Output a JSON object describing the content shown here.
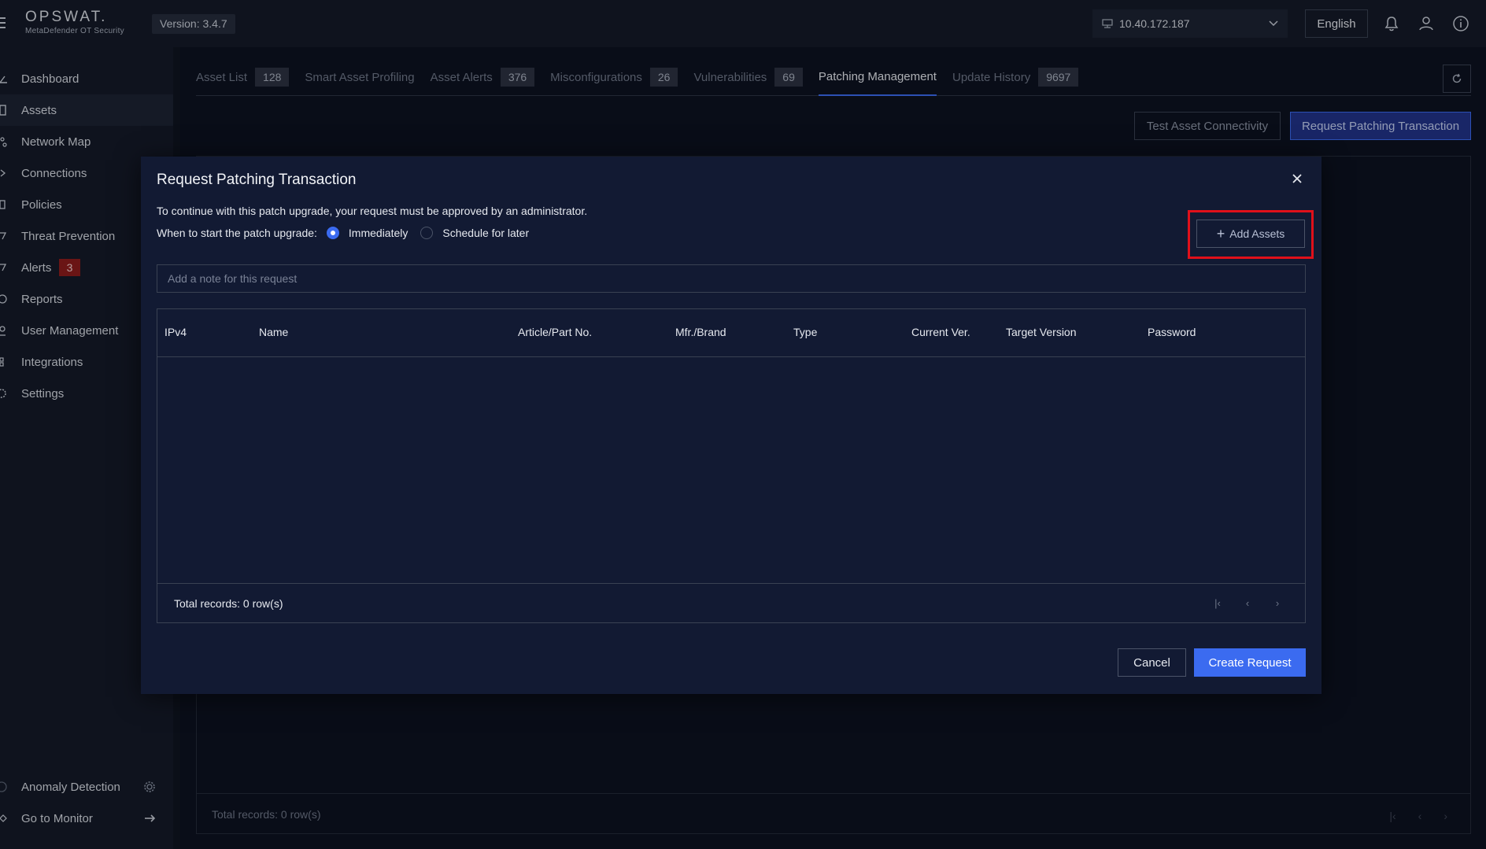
{
  "app": {
    "brand": "OPSWAT.",
    "product": "MetaDefender OT Security",
    "version": "Version: 3.4.7"
  },
  "topbar": {
    "ip": "10.40.172.187",
    "language": "English",
    "icons": [
      "network-icon",
      "chevron-down-icon",
      "bell-icon",
      "user-icon",
      "info-icon"
    ]
  },
  "sidebar": {
    "items": [
      {
        "label": "Dashboard",
        "icon": "dashboard-icon"
      },
      {
        "label": "Assets",
        "icon": "assets-icon",
        "active": true
      },
      {
        "label": "Network Map",
        "icon": "network-map-icon"
      },
      {
        "label": "Connections",
        "icon": "connections-icon"
      },
      {
        "label": "Policies",
        "icon": "policies-icon"
      },
      {
        "label": "Threat Prevention",
        "icon": "threat-prevention-icon"
      },
      {
        "label": "Alerts",
        "icon": "alerts-icon",
        "badge": "3"
      },
      {
        "label": "Reports",
        "icon": "reports-icon"
      },
      {
        "label": "User Management",
        "icon": "user-management-icon"
      },
      {
        "label": "Integrations",
        "icon": "integrations-icon"
      },
      {
        "label": "Settings",
        "icon": "settings-icon"
      }
    ],
    "bottom": [
      {
        "label": "Anomaly Detection",
        "icon": "anomaly-icon",
        "right_icon": "gear-icon"
      },
      {
        "label": "Go to Monitor",
        "icon": "monitor-icon",
        "right_icon": "arrow-right-icon"
      }
    ]
  },
  "main": {
    "tabs": [
      {
        "label": "Asset List",
        "count": "128"
      },
      {
        "label": "Smart Asset Profiling"
      },
      {
        "label": "Asset Alerts",
        "count": "376"
      },
      {
        "label": "Misconfigurations",
        "count": "26"
      },
      {
        "label": "Vulnerabilities",
        "count": "69"
      },
      {
        "label": "Patching Management",
        "active": true
      },
      {
        "label": "Update History",
        "count": "9697"
      }
    ],
    "test_connectivity_label": "Test Asset Connectivity",
    "request_patching_label": "Request Patching Transaction",
    "total_records": "Total records: 0 row(s)"
  },
  "modal": {
    "title": "Request Patching Transaction",
    "description": "To continue with this patch upgrade, your request must be approved by an administrator.",
    "when_label": "When to start the patch upgrade:",
    "options": [
      "Immediately",
      "Schedule for later"
    ],
    "selected_option": "Immediately",
    "add_assets_label": "Add Assets",
    "note_placeholder": "Add a note for this request",
    "note_value": "",
    "columns": [
      "IPv4",
      "Name",
      "Article/Part No.",
      "Mfr./Brand",
      "Type",
      "Current Ver.",
      "Target Version",
      "Password"
    ],
    "rows": [],
    "total_records": "Total records: 0 row(s)",
    "cancel_label": "Cancel",
    "create_label": "Create Request"
  },
  "colors": {
    "accent": "#3b6bf0",
    "highlight": "#e0101a",
    "alert_badge": "#8e1c1c"
  }
}
